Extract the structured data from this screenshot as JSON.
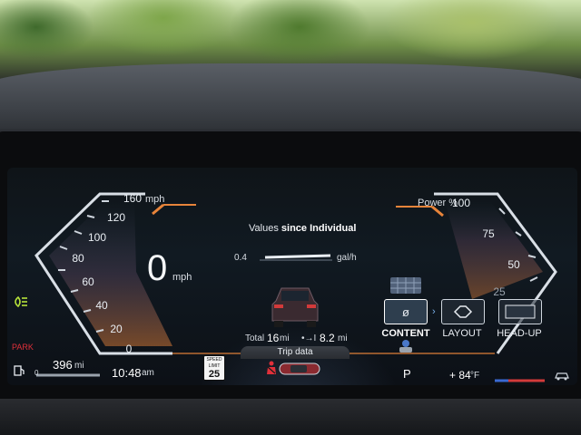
{
  "speedometer": {
    "ticks": [
      "160",
      "120",
      "100",
      "80",
      "60",
      "40",
      "20",
      "0"
    ],
    "top_unit": "mph",
    "speed_value": "0",
    "speed_unit": "mph"
  },
  "center": {
    "values_prefix": "Values",
    "values_mode": "since Individual",
    "consumption_min": "0.4",
    "consumption_unit": "gal/h",
    "total_label": "Total",
    "total_value": "16",
    "total_unit": "mi",
    "trip_value": "8.2",
    "trip_unit": "mi",
    "tab_label": "Trip data"
  },
  "power_gauge": {
    "label": "Power %",
    "ticks": [
      "100",
      "75",
      "50",
      "25"
    ]
  },
  "menu": {
    "items": [
      {
        "label": "CONTENT",
        "glyph": "ø",
        "active": true
      },
      {
        "label": "LAYOUT",
        "glyph": "",
        "active": false
      },
      {
        "label": "HEAD-UP",
        "glyph": "",
        "active": false
      }
    ]
  },
  "status_bar": {
    "range_value": "396",
    "range_unit": "mi",
    "fuel_min": "0",
    "clock": "10:48",
    "clock_ampm": "am",
    "speed_limit_caption_1": "SPEED",
    "speed_limit_caption_2": "LIMIT",
    "speed_limit_value": "25",
    "gear": "P",
    "temperature": "+ 84",
    "temperature_unit": "°F",
    "park_indicator": "PARK"
  },
  "colors": {
    "accent_orange": "#e8843a",
    "park_red": "#e0303a",
    "headlight_green": "#b6e23a",
    "gauge_white": "#e9eef3"
  }
}
